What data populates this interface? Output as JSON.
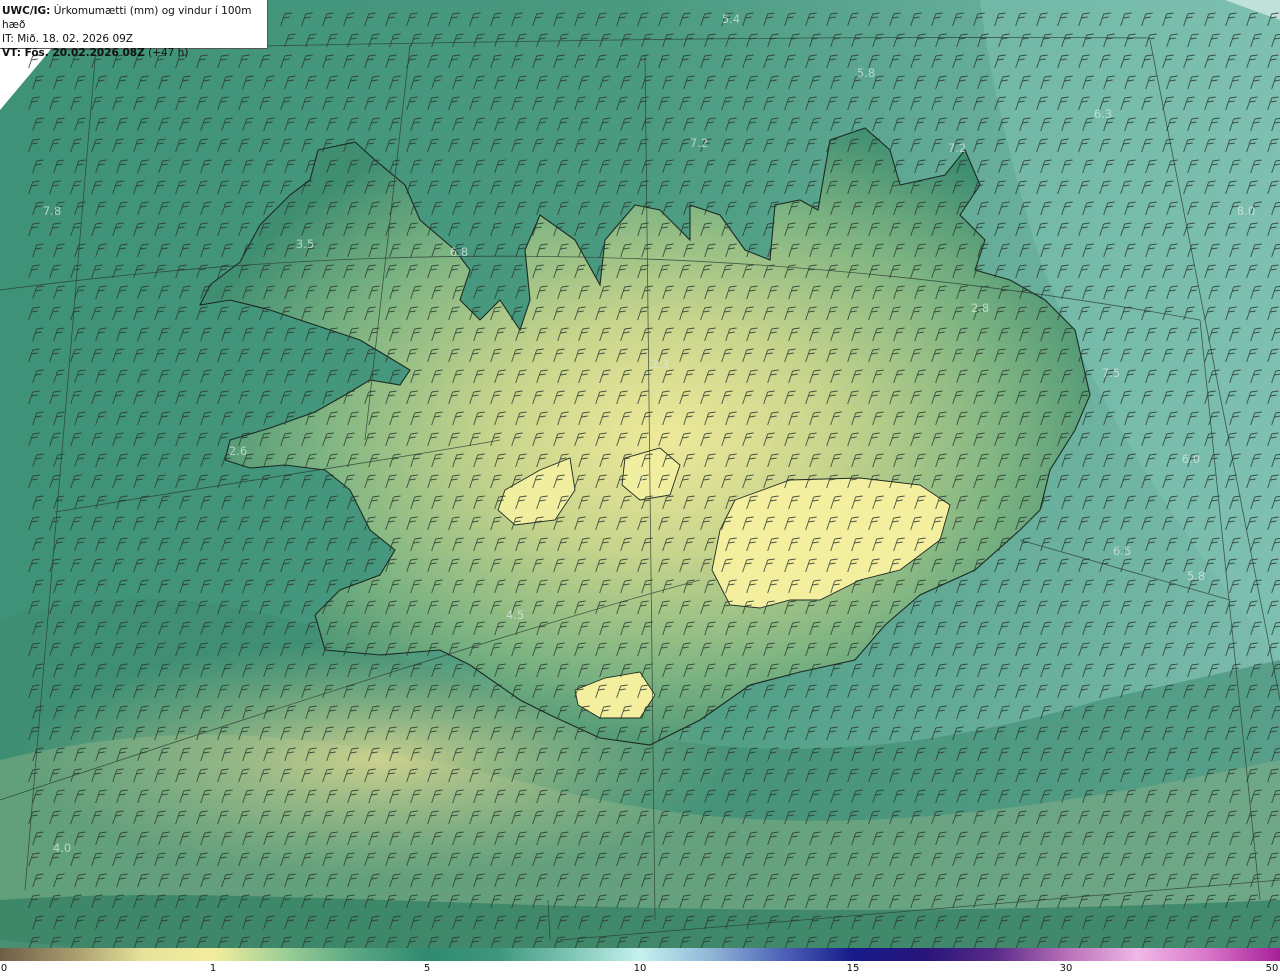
{
  "header": {
    "product": "UWC/IG:",
    "description": " Úrkomumætti (mm) og vindur í 100m hæð",
    "issue_time": "IT: Mið. 18. 02. 2026 09Z",
    "valid_label": "VT: Fös. 20.02.2026 08Z",
    "valid_lead": " (+47 h)"
  },
  "value_labels": [
    "5.4",
    "5.8",
    "6.3",
    "7.2",
    "7.2",
    "7.8",
    "3.5",
    "6.8",
    "8.0",
    "2.8",
    "2.3",
    "7.5",
    "2.6",
    "6.0",
    "0",
    "6.5",
    "5.8",
    "4.5",
    "4.0"
  ],
  "colorbar": {
    "ticks": [
      "0",
      "1",
      "5",
      "10",
      "15",
      "30",
      "50"
    ],
    "colors": [
      "#6e5e48",
      "#a69a6c",
      "#e6e29a",
      "#f3ee9c",
      "#9ccf94",
      "#5aa784",
      "#2f8a6f",
      "#3e977d",
      "#7cc5b4",
      "#c6f1ee",
      "#8fb6d6",
      "#4e63b8",
      "#161a8a",
      "#27157a",
      "#5a2b8a",
      "#b86fb8",
      "#f0b8e6",
      "#d874c8",
      "#a61f98"
    ]
  }
}
